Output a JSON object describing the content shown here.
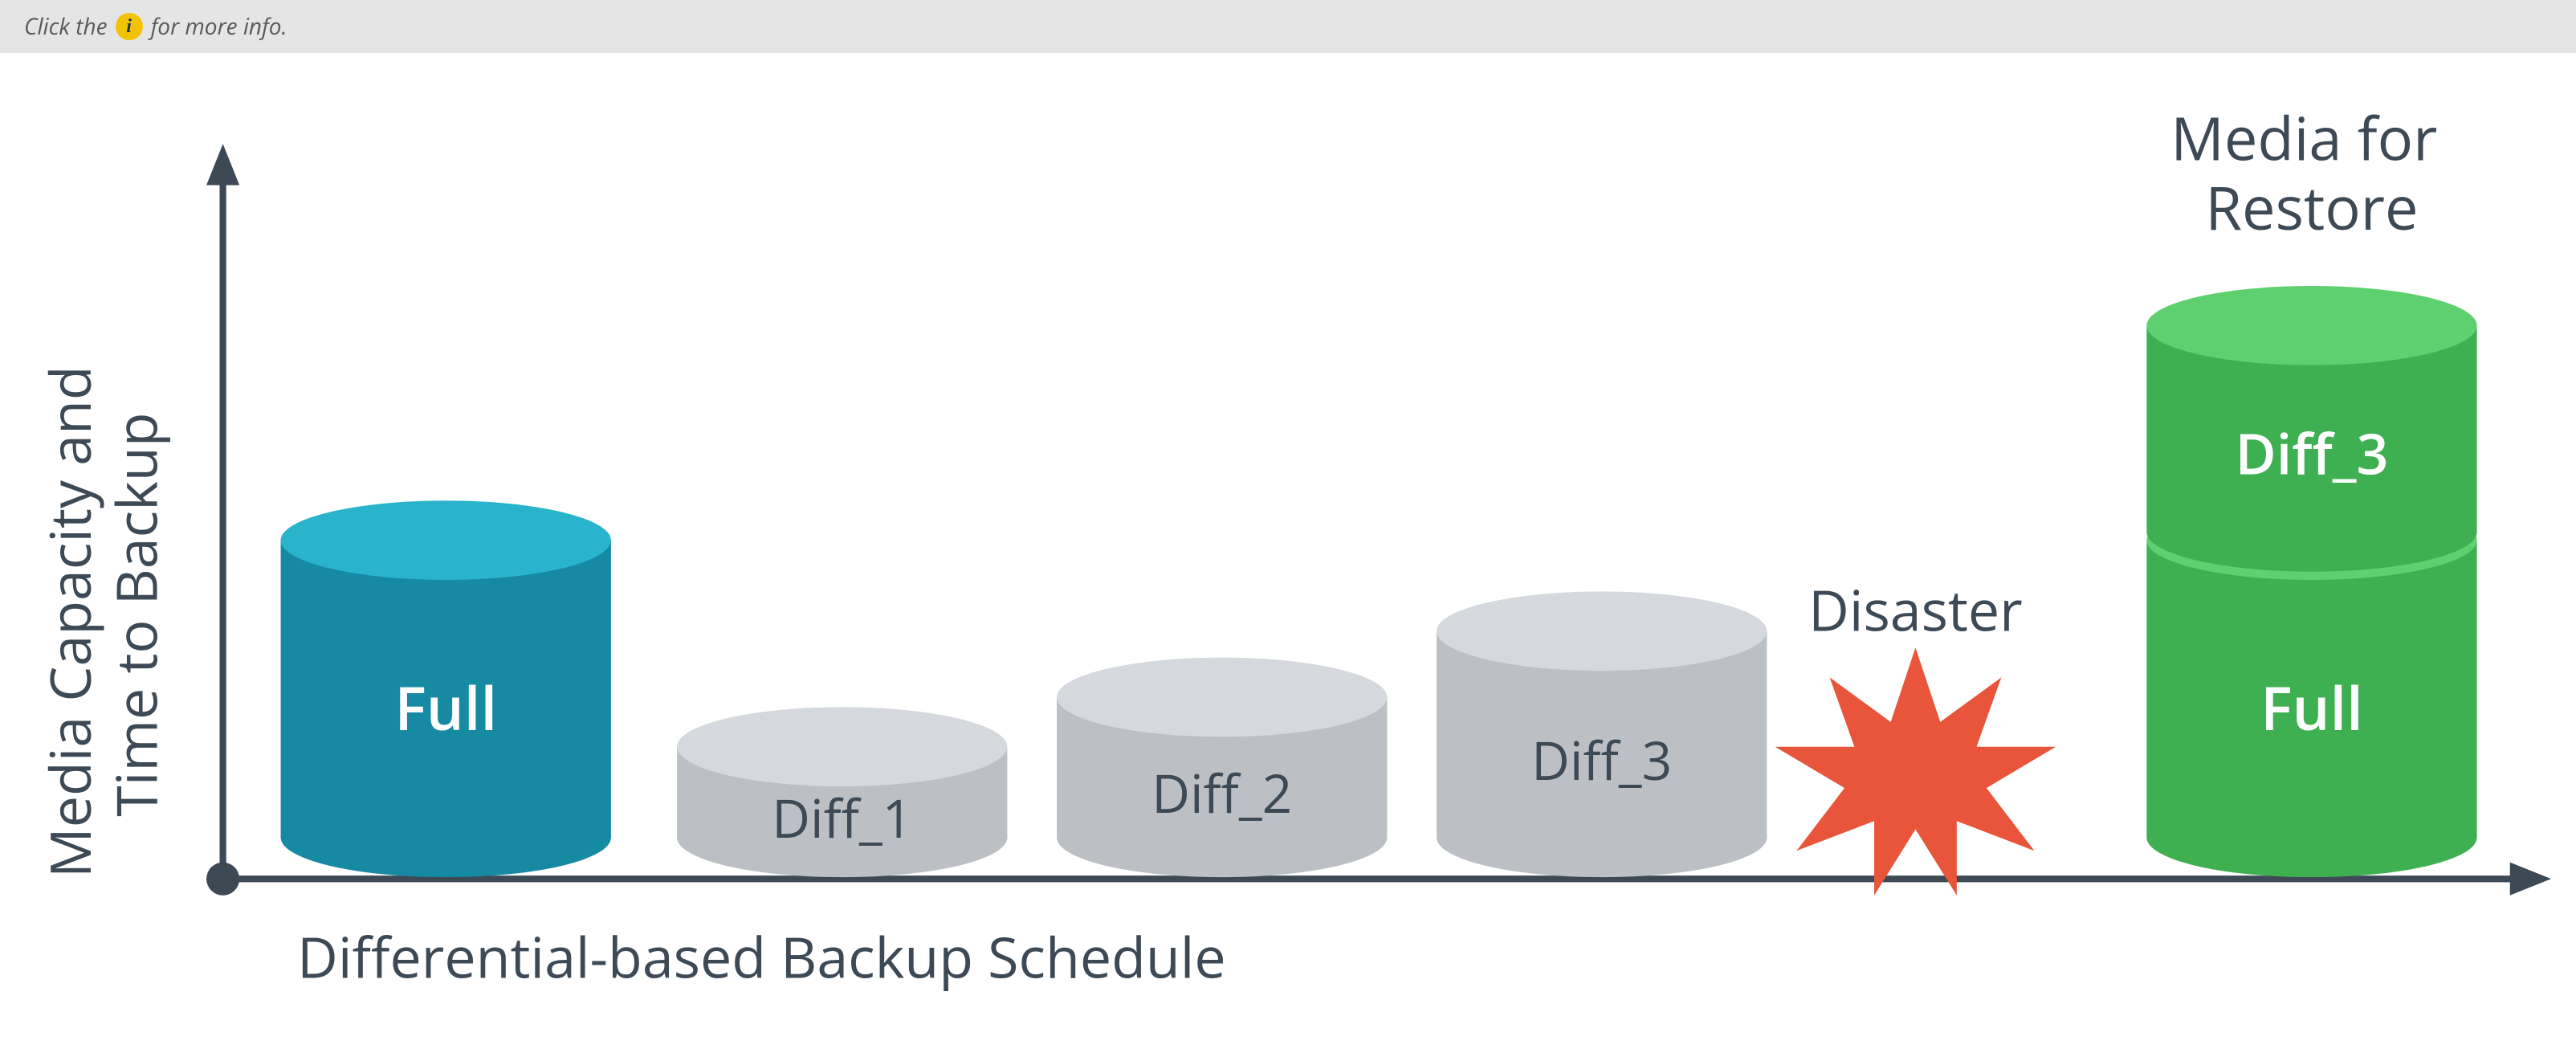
{
  "info_bar": {
    "prefix": "Click the",
    "suffix": "for more info.",
    "icon_glyph": "i"
  },
  "diagram": {
    "y_axis_label_line1": "Media Capacity and",
    "y_axis_label_line2": "Time to Backup",
    "x_axis_label": "Differential-based Backup Schedule",
    "cylinders": {
      "full": {
        "label": "Full"
      },
      "diff1": {
        "label": "Diff_1"
      },
      "diff2": {
        "label": "Diff_2"
      },
      "diff3": {
        "label": "Diff_3"
      }
    },
    "disaster_label": "Disaster",
    "restore": {
      "title_line1": "Media for",
      "title_line2": "Restore",
      "top_label": "Diff_3",
      "bottom_label": "Full"
    }
  },
  "chart_data": {
    "type": "bar",
    "title": "Differential-based Backup Schedule",
    "xlabel": "Differential-based Backup Schedule",
    "ylabel": "Media Capacity and Time to Backup",
    "categories": [
      "Full",
      "Diff_1",
      "Diff_2",
      "Diff_3"
    ],
    "values": [
      180,
      55,
      85,
      125
    ],
    "annotations": [
      "Disaster"
    ],
    "restore_stack": [
      {
        "label": "Full",
        "value": 180
      },
      {
        "label": "Diff_3",
        "value": 125
      }
    ],
    "note": "Values are relative cylinder heights estimated from the figure; the chart has no numeric axis ticks."
  }
}
